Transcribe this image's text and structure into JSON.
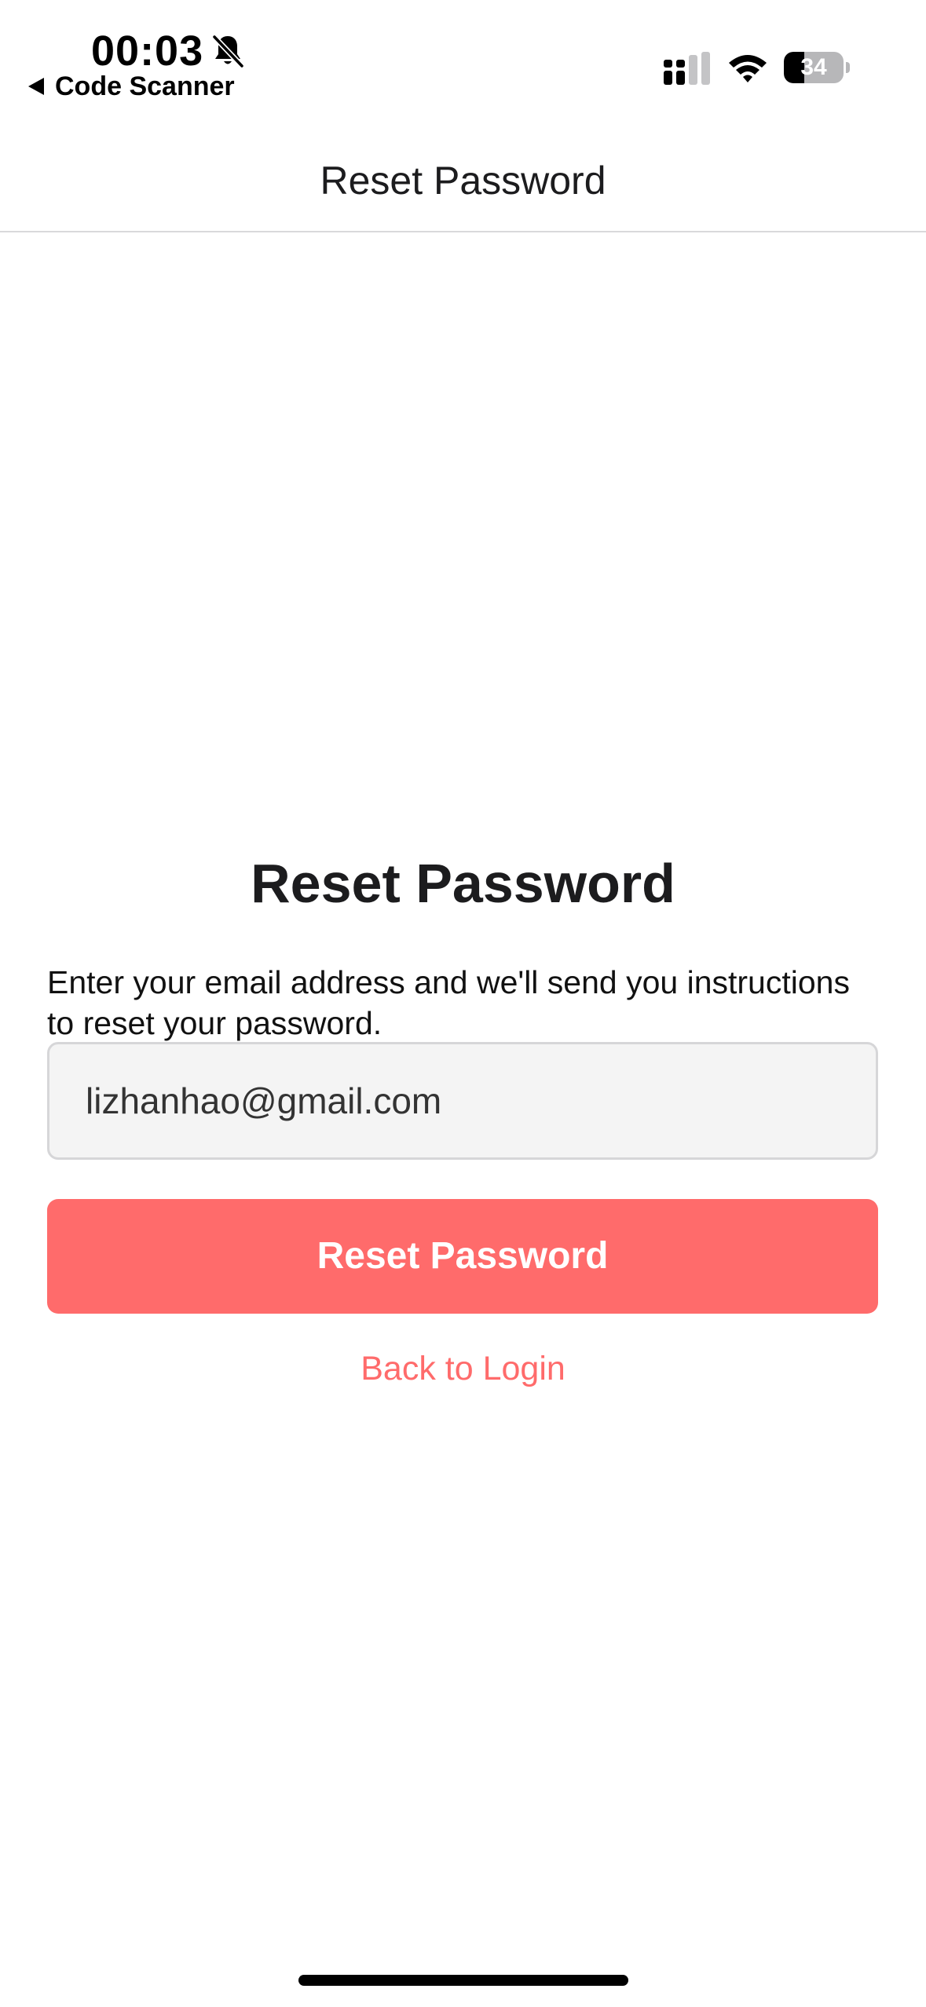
{
  "status_bar": {
    "time": "00:03",
    "mute_icon": "bell-slash-icon",
    "back_app_label": "Code Scanner",
    "signal_icon": "cellular-signal-icon",
    "wifi_icon": "wifi-icon",
    "battery_level": "34",
    "battery_fraction": 0.34
  },
  "nav": {
    "title": "Reset Password"
  },
  "main": {
    "heading": "Reset Password",
    "instructions": "Enter your email address and we'll send you instructions to reset your password.",
    "email_value": "lizhanhao@gmail.com",
    "reset_button_label": "Reset Password",
    "back_to_login_label": "Back to Login"
  },
  "colors": {
    "accent": "#ff6b6b",
    "input_background": "#f4f4f4",
    "input_border": "#d6d6d8",
    "text": "#1c1c1e"
  }
}
